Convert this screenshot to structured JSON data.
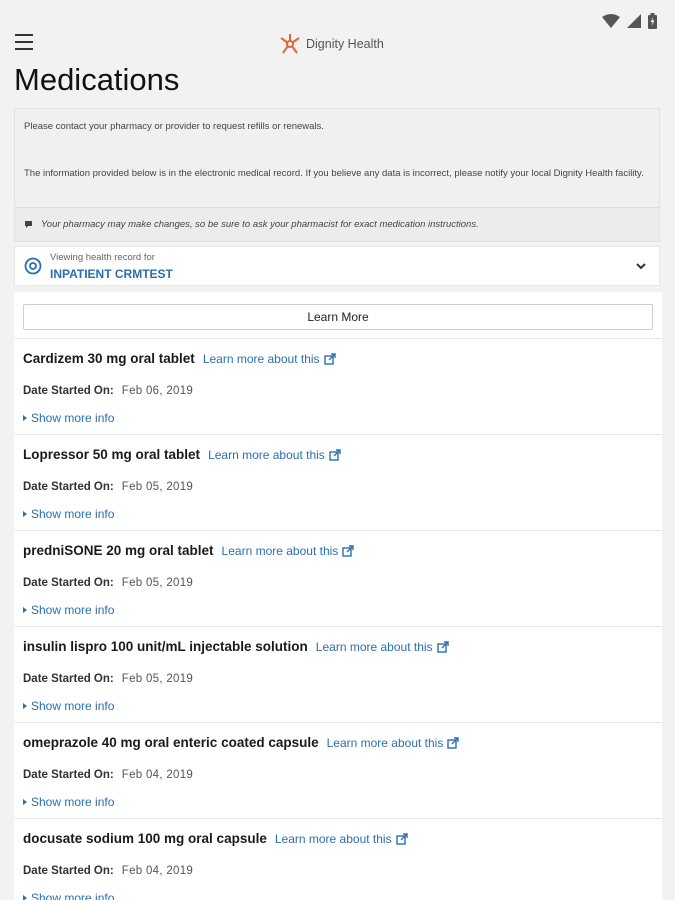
{
  "header": {
    "brand": "Dignity Health",
    "title": "Medications"
  },
  "notice": {
    "contact": "Please contact your pharmacy or provider to request refills or renewals.",
    "info": "The information provided below is in the electronic medical record. If you believe any data is incorrect, please notify your local Dignity Health facility.",
    "tip": "Your pharmacy may make changes, so be sure to ask your pharmacist for exact medication instructions."
  },
  "record": {
    "caption": "Viewing health record for",
    "name": "INPATIENT CRMTEST"
  },
  "learn_more_label": "Learn More",
  "date_label": "Date Started On:",
  "link_label": "Learn more about this",
  "more_label": "Show more info",
  "medications": [
    {
      "name": "Cardizem 30 mg oral tablet",
      "date": "Feb 06, 2019"
    },
    {
      "name": "Lopressor 50 mg oral tablet",
      "date": "Feb 05, 2019"
    },
    {
      "name": "predniSONE 20 mg oral tablet",
      "date": "Feb 05, 2019"
    },
    {
      "name": "insulin lispro 100 unit/mL injectable solution",
      "date": "Feb 05, 2019"
    },
    {
      "name": "omeprazole 40 mg oral enteric coated capsule",
      "date": "Feb 04, 2019"
    },
    {
      "name": "docusate sodium 100 mg oral capsule",
      "date": "Feb 04, 2019"
    }
  ],
  "icons": {
    "status": [
      "wifi-icon",
      "signal-icon",
      "battery-icon"
    ],
    "menu": "menu-icon",
    "logo": "dignity-health-logo-icon",
    "tip": "tip-icon",
    "record": "record-icon",
    "chevron": "chevron-down-icon",
    "external": "external-link-icon"
  },
  "colors": {
    "link": "#2a6fb0",
    "brand": "#e0673a",
    "background": "#f2f2f2"
  }
}
